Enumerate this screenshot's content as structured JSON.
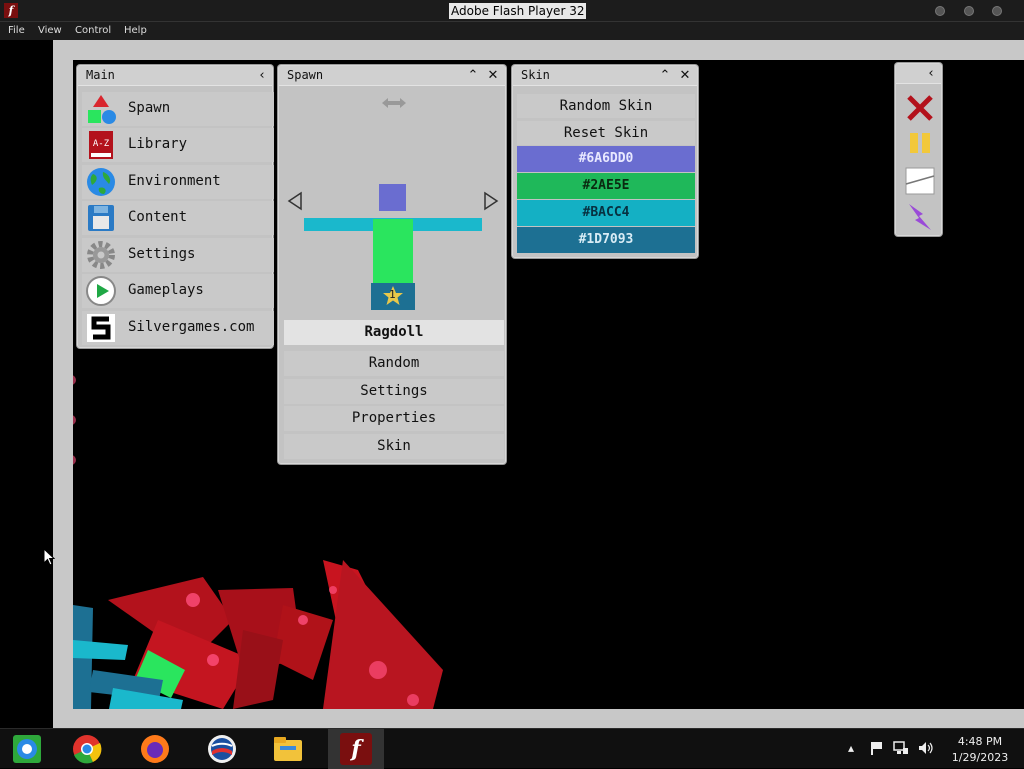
{
  "window": {
    "title": "Adobe Flash Player 32"
  },
  "menu": {
    "items": [
      "File",
      "View",
      "Control",
      "Help"
    ]
  },
  "main_panel": {
    "title": "Main",
    "items": [
      {
        "label": "Spawn",
        "icon": "shapes-icon"
      },
      {
        "label": "Library",
        "icon": "book-icon"
      },
      {
        "label": "Environment",
        "icon": "globe-icon"
      },
      {
        "label": "Content",
        "icon": "floppy-disk-icon"
      },
      {
        "label": "Settings",
        "icon": "gear-icon"
      },
      {
        "label": "Gameplays",
        "icon": "play-icon"
      },
      {
        "label": "Silvergames.com",
        "icon": "silvergames-logo-icon"
      }
    ]
  },
  "spawn_panel": {
    "title": "Spawn",
    "selected_name": "Ragdoll",
    "badge_number": "1",
    "buttons": [
      "Random",
      "Settings",
      "Properties",
      "Skin"
    ]
  },
  "skin_panel": {
    "title": "Skin",
    "random_label": "Random Skin",
    "reset_label": "Reset Skin",
    "colors": [
      {
        "hex": "#6A6DD0",
        "value": "#6A6DD0"
      },
      {
        "hex": "#2AE5E",
        "value": "#2AE55E"
      },
      {
        "hex": "#BACC4",
        "value": "#00BACC4"
      },
      {
        "hex": "#1D7093",
        "value": "#1D7093"
      }
    ]
  },
  "taskbar": {
    "time": "4:48 PM",
    "date": "1/29/2023"
  },
  "colors": {
    "ragdoll_head": "#6A6DD0",
    "ragdoll_torso": "#2AE55E",
    "ragdoll_arms": "#1AB8CC",
    "ragdoll_legs": "#1D7093"
  }
}
